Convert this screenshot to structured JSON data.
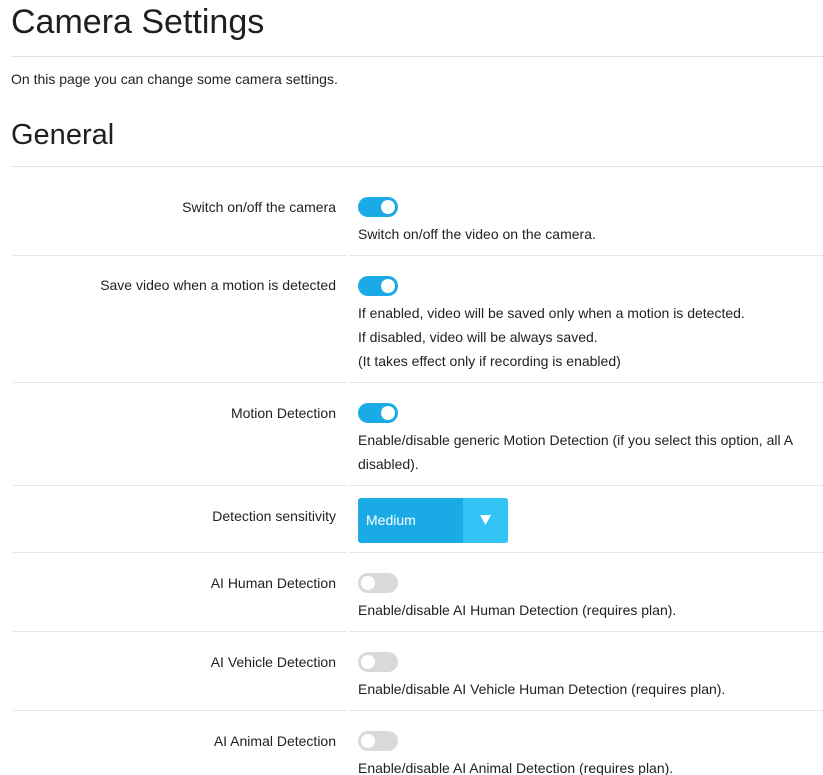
{
  "page": {
    "title": "Camera Settings",
    "intro": "On this page you can change some camera settings."
  },
  "section": {
    "title": "General"
  },
  "settings": [
    {
      "label": "Switch on/off the camera",
      "enabled": true,
      "description": [
        "Switch on/off the video on the camera."
      ]
    },
    {
      "label": "Save video when a motion is detected",
      "enabled": true,
      "description": [
        "If enabled, video will be saved only when a motion is detected.",
        "If disabled, video will be always saved.",
        "(It takes effect only if recording is enabled)"
      ]
    },
    {
      "label": "Motion Detection",
      "enabled": true,
      "description": [
        "Enable/disable generic Motion Detection (if you select this option, all A",
        "disabled)."
      ]
    },
    {
      "label": "Detection sensitivity",
      "select_value": "Medium"
    },
    {
      "label": "AI Human Detection",
      "enabled": false,
      "description": [
        "Enable/disable AI Human Detection (requires plan)."
      ]
    },
    {
      "label": "AI Vehicle Detection",
      "enabled": false,
      "description": [
        "Enable/disable AI Vehicle Human Detection (requires plan)."
      ]
    },
    {
      "label": "AI Animal Detection",
      "enabled": false,
      "description": [
        "Enable/disable AI Animal Detection (requires plan)."
      ]
    }
  ],
  "colors": {
    "accent": "#1aabe6",
    "toggle_off": "#d9d9d9"
  }
}
